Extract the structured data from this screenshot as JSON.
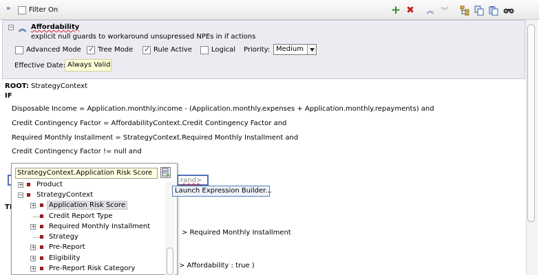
{
  "toolbar": {
    "filter_label": "Filter On",
    "icons": [
      "collapse-icon",
      "add-icon",
      "delete-icon",
      "move-up-icon",
      "move-down-icon",
      "tree-icon",
      "copy-icon",
      "paste-icon",
      "find-icon"
    ],
    "colors": {
      "add": "#2e8b2e",
      "delete": "#c81e1e",
      "nav": "#3e64a8"
    }
  },
  "rule": {
    "title": "Affordability",
    "description": "explicit null guards to workaround unsupressed NPEs in if actions",
    "advanced_mode_label": "Advanced Mode",
    "advanced_mode_checked": false,
    "tree_mode_label": "Tree Mode",
    "tree_mode_checked": true,
    "rule_active_label": "Rule Active",
    "rule_active_checked": true,
    "logical_label": "Logical",
    "logical_checked": false,
    "priority_label": "Priority:",
    "priority_value": "Medium",
    "effective_date_label": "Effective Date:",
    "effective_date_value": "Always Valid"
  },
  "main": {
    "root_label": "ROOT:",
    "root_value": "StrategyContext",
    "if_label": "IF",
    "conditions": [
      "Disposable Income = Application.monthly.income - (Application.monthly.expenses + Application.monthly.repayments) and",
      "Credit Contingency Factor = AffordabilityContext.Credit Contingency Factor and",
      "Required Monthly Installment = StrategyContext.Required Monthly Installment and",
      "Credit Contingency Factor  !=  null and"
    ],
    "operand_placeholder": "rand>",
    "then_fragment": "TI",
    "then_lines": [
      ">  Required Monthly Installment",
      ">  Affordability : true  )"
    ]
  },
  "popup": {
    "input_value": "StrategyContext.Application Risk Score",
    "tree": [
      {
        "label": "Product",
        "level": 0,
        "expander": "+"
      },
      {
        "label": "StrategyContext",
        "level": 0,
        "expander": "-"
      },
      {
        "label": "Application Risk Score",
        "level": 1,
        "expander": "+",
        "selected": true
      },
      {
        "label": "Credit Report Type",
        "level": 1,
        "expander": ""
      },
      {
        "label": "Required Monthly Installment",
        "level": 1,
        "expander": "+"
      },
      {
        "label": "Strategy",
        "level": 1,
        "expander": ""
      },
      {
        "label": "Pre-Report",
        "level": 1,
        "expander": "+"
      },
      {
        "label": "Eligibility",
        "level": 1,
        "expander": "+"
      },
      {
        "label": "Pre-Report Risk Category",
        "level": 1,
        "expander": "+"
      }
    ]
  },
  "tooltip": {
    "text": "Launch Expression Builder..."
  }
}
